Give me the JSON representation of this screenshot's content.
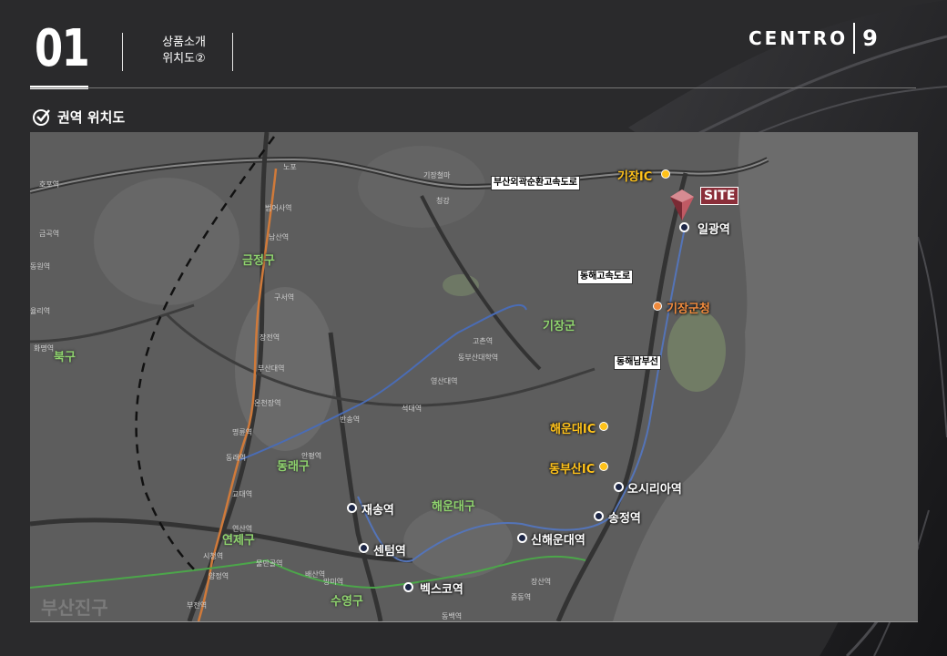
{
  "header": {
    "page_number": "01",
    "section_line1": "상품소개",
    "section_line2": "위치도②",
    "logo_text": "CENTRO",
    "logo_number": "9"
  },
  "map_title": "권역 위치도",
  "site_label": "SITE",
  "districts": {
    "geumjeong": "금정구",
    "buk": "북구",
    "dongnae": "동래구",
    "yeonje": "연제구",
    "haeundae": "해운대구",
    "suyeong": "수영구",
    "gijang": "기장군",
    "busanjin": "부산진구"
  },
  "stations": {
    "ilgwang": "일광역",
    "osiria": "오시리아역",
    "songjeong": "송정역",
    "sinhaeundae": "신해운대역",
    "jaesong": "재송역",
    "centum": "센텀역",
    "bexco": "벡스코역"
  },
  "ics": {
    "gijang_ic": "기장IC",
    "haeundae_ic": "해운대IC",
    "dongbusan_ic": "동부산IC"
  },
  "office": "기장군청",
  "roads": {
    "outer_ring": "부산외곽순환고속도로",
    "donghae_express": "동해고속도로",
    "donghae_line": "동해남부선"
  },
  "small_labels": {
    "s1": "호포역",
    "s2": "금곡역",
    "s3": "동원역",
    "s4": "율리역",
    "s5": "화명역",
    "s6": "범어사역",
    "s7": "남산역",
    "s8": "구서역",
    "s9": "장전역",
    "s10": "부산대역",
    "s11": "온천장역",
    "s12": "명륜역",
    "s13": "동래역",
    "s14": "교대역",
    "s15": "연산역",
    "s16": "시청역",
    "s17": "양정역",
    "s18": "부전역",
    "s19": "안평역",
    "s20": "반송역",
    "s21": "석대역",
    "s22": "영산대역",
    "s23": "고촌역",
    "s24": "동부산대학역",
    "s25": "물만골역",
    "s26": "배산역",
    "s27": "망미역",
    "s28": "장산역",
    "s29": "중동역",
    "s30": "동백역",
    "s31": "노포",
    "s32": "기장철마",
    "s33": "청강"
  }
}
